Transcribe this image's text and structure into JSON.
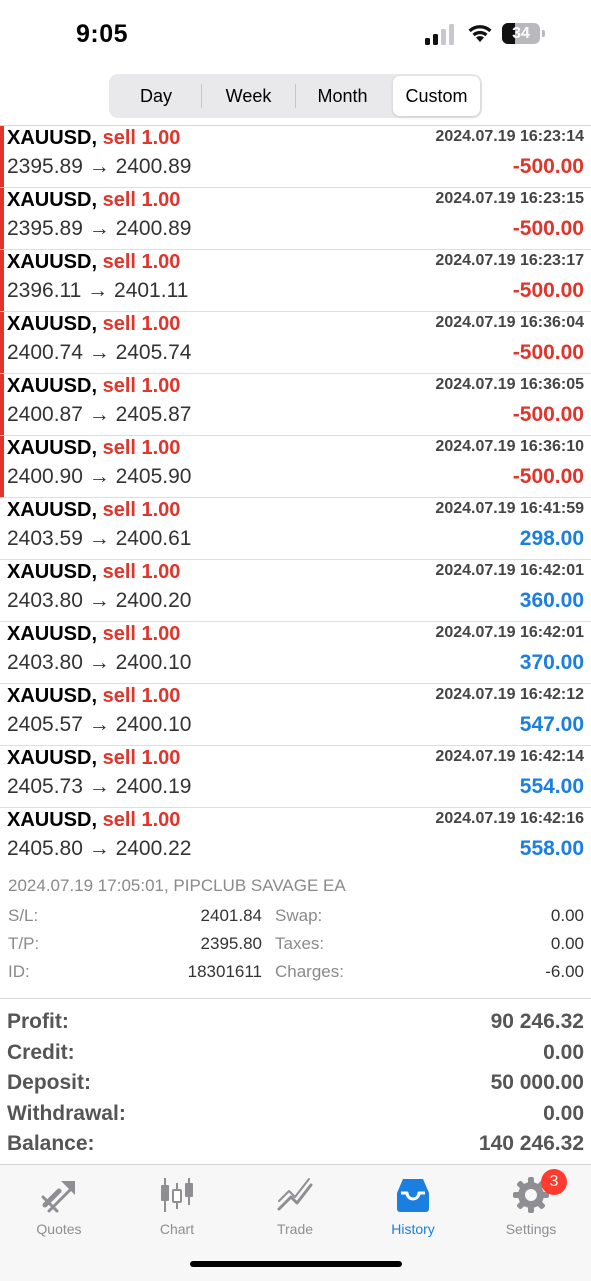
{
  "status": {
    "time": "9:05",
    "battery": "34"
  },
  "period_tabs": [
    {
      "label": "Day",
      "active": false
    },
    {
      "label": "Week",
      "active": false
    },
    {
      "label": "Month",
      "active": false
    },
    {
      "label": "Custom",
      "active": true
    }
  ],
  "deals": [
    {
      "symbol": "XAUUSD,",
      "side": "sell 1.00",
      "prices": "2395.89 → 2400.89",
      "time": "2024.07.19 16:23:14",
      "profit": "-500.00",
      "loss": true
    },
    {
      "symbol": "XAUUSD,",
      "side": "sell 1.00",
      "prices": "2395.89 → 2400.89",
      "time": "2024.07.19 16:23:15",
      "profit": "-500.00",
      "loss": true
    },
    {
      "symbol": "XAUUSD,",
      "side": "sell 1.00",
      "prices": "2396.11 → 2401.11",
      "time": "2024.07.19 16:23:17",
      "profit": "-500.00",
      "loss": true
    },
    {
      "symbol": "XAUUSD,",
      "side": "sell 1.00",
      "prices": "2400.74 → 2405.74",
      "time": "2024.07.19 16:36:04",
      "profit": "-500.00",
      "loss": true
    },
    {
      "symbol": "XAUUSD,",
      "side": "sell 1.00",
      "prices": "2400.87 → 2405.87",
      "time": "2024.07.19 16:36:05",
      "profit": "-500.00",
      "loss": true
    },
    {
      "symbol": "XAUUSD,",
      "side": "sell 1.00",
      "prices": "2400.90 → 2405.90",
      "time": "2024.07.19 16:36:10",
      "profit": "-500.00",
      "loss": true
    },
    {
      "symbol": "XAUUSD,",
      "side": "sell 1.00",
      "prices": "2403.59 → 2400.61",
      "time": "2024.07.19 16:41:59",
      "profit": "298.00",
      "loss": false
    },
    {
      "symbol": "XAUUSD,",
      "side": "sell 1.00",
      "prices": "2403.80 → 2400.20",
      "time": "2024.07.19 16:42:01",
      "profit": "360.00",
      "loss": false
    },
    {
      "symbol": "XAUUSD,",
      "side": "sell 1.00",
      "prices": "2403.80 → 2400.10",
      "time": "2024.07.19 16:42:01",
      "profit": "370.00",
      "loss": false
    },
    {
      "symbol": "XAUUSD,",
      "side": "sell 1.00",
      "prices": "2405.57 → 2400.10",
      "time": "2024.07.19 16:42:12",
      "profit": "547.00",
      "loss": false
    },
    {
      "symbol": "XAUUSD,",
      "side": "sell 1.00",
      "prices": "2405.73 → 2400.19",
      "time": "2024.07.19 16:42:14",
      "profit": "554.00",
      "loss": false
    },
    {
      "symbol": "XAUUSD,",
      "side": "sell 1.00",
      "prices": "2405.80 → 2400.22",
      "time": "2024.07.19 16:42:16",
      "profit": "558.00",
      "loss": false
    }
  ],
  "details": {
    "header": "2024.07.19 17:05:01, PIPCLUB SAVAGE EA",
    "sl_label": "S/L:",
    "sl_value": "2401.84",
    "swap_label": "Swap:",
    "swap_value": "0.00",
    "tp_label": "T/P:",
    "tp_value": "2395.80",
    "taxes_label": "Taxes:",
    "taxes_value": "0.00",
    "id_label": "ID:",
    "id_value": "18301611",
    "charges_label": "Charges:",
    "charges_value": "-6.00"
  },
  "summary": {
    "profit_label": "Profit:",
    "profit_value": "90 246.32",
    "credit_label": "Credit:",
    "credit_value": "0.00",
    "deposit_label": "Deposit:",
    "deposit_value": "50 000.00",
    "withdrawal_label": "Withdrawal:",
    "withdrawal_value": "0.00",
    "balance_label": "Balance:",
    "balance_value": "140 246.32"
  },
  "tabs": {
    "quotes": "Quotes",
    "chart": "Chart",
    "trade": "Trade",
    "history": "History",
    "settings": "Settings",
    "settings_badge": "3"
  },
  "colors": {
    "loss": "#e0352b",
    "profit": "#1a7fe0",
    "accent": "#1a7fe0"
  },
  "icons": [
    "signal-icon",
    "wifi-icon",
    "battery-icon",
    "quotes-icon",
    "chart-icon",
    "trade-icon",
    "history-icon",
    "settings-icon"
  ]
}
